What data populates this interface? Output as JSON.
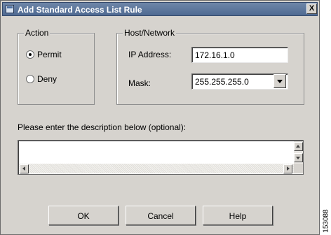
{
  "window": {
    "title": "Add Standard Access List Rule",
    "close_label": "X"
  },
  "action": {
    "legend": "Action",
    "permit_label": "Permit",
    "deny_label": "Deny",
    "selected": "Permit"
  },
  "host_network": {
    "legend": "Host/Network",
    "ip_label": "IP Address:",
    "ip_value": "172.16.1.0",
    "mask_label": "Mask:",
    "mask_value": "255.255.255.0"
  },
  "description": {
    "prompt": "Please enter the description below (optional):",
    "value": ""
  },
  "buttons": {
    "ok": "OK",
    "cancel": "Cancel",
    "help": "Help"
  },
  "figure_id": "153088"
}
